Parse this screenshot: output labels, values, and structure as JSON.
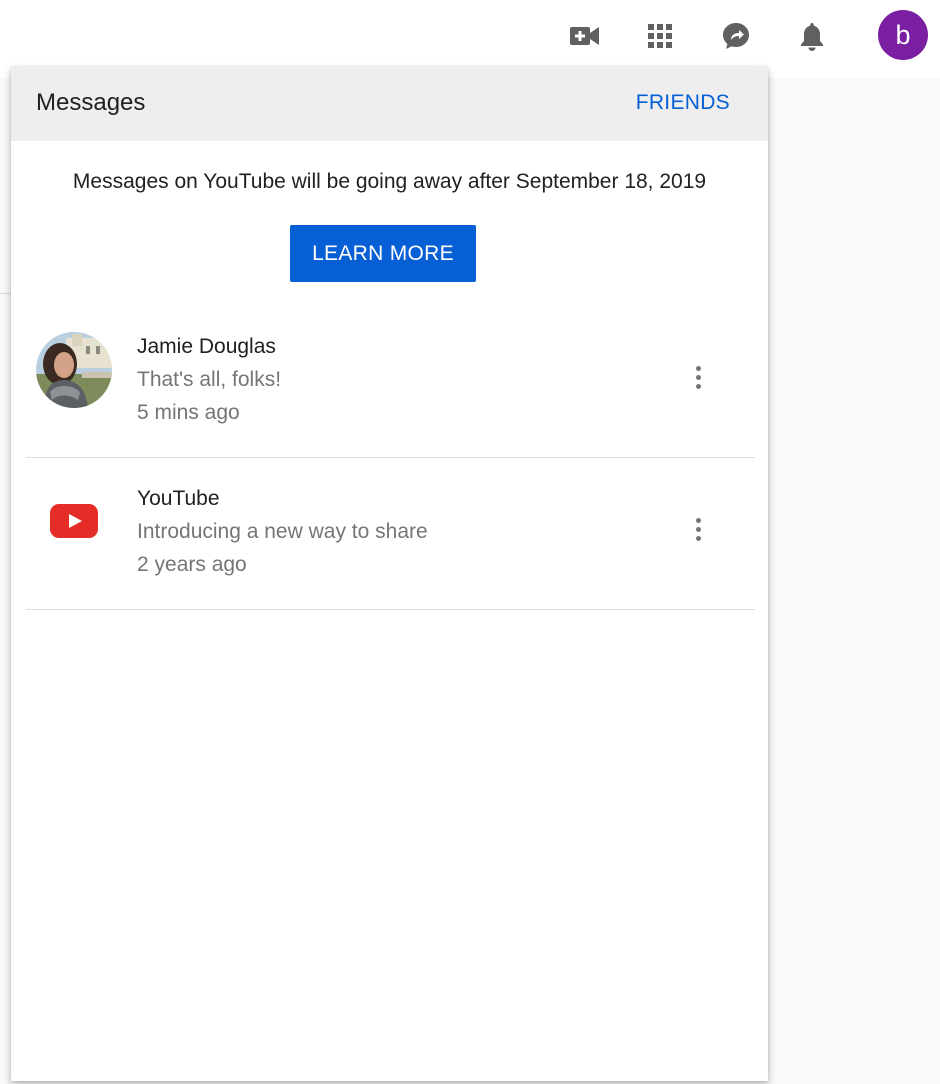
{
  "topbar": {
    "icons": {
      "create": "video-camera-plus-icon",
      "apps": "apps-grid-icon",
      "messages": "message-share-icon",
      "notifications": "bell-icon"
    },
    "avatar_letter": "b",
    "avatar_color": "#7b1fa2"
  },
  "panel": {
    "title": "Messages",
    "friends_label": "FRIENDS",
    "notice": "Messages on YouTube will be going away after September 18, 2019",
    "learn_more_label": "LEARN MORE",
    "accent_color": "#065fd4",
    "messages": [
      {
        "name": "Jamie Douglas",
        "snippet": "That's all, folks!",
        "time": "5 mins ago",
        "avatar": "profile-photo"
      },
      {
        "name": "YouTube",
        "snippet": "Introducing a new way to share",
        "time": "2 years ago",
        "avatar": "youtube-logo-icon"
      }
    ]
  }
}
